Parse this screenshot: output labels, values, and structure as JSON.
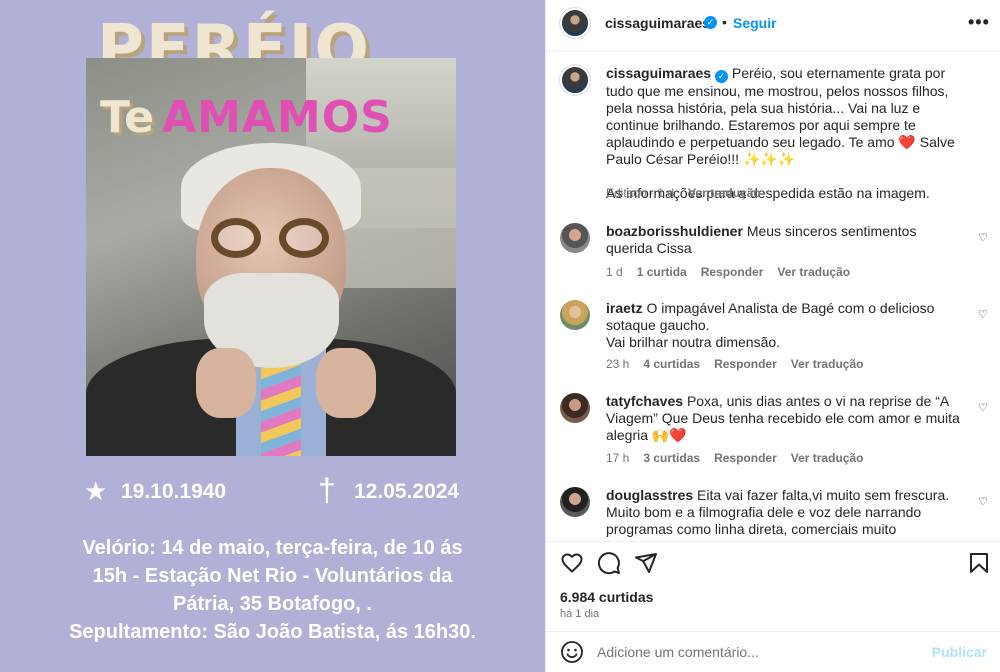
{
  "post_image": {
    "title_line1": "PERÉIO",
    "title_te": "Te",
    "title_amamos": "AMAMOS",
    "birth_date": "19.10.1940",
    "death_date": "12.05.2024",
    "info_lines": [
      "Velório: 14 de maio, terça-feira, de 10 ás",
      "15h - Estação Net Rio - Voluntários da",
      "Pátria, 35 Botafogo, .",
      "Sepultamento: São João Batista, ás 16h30."
    ]
  },
  "header": {
    "username": "cissaguimaraes",
    "separator": "•",
    "follow_label": "Seguir",
    "more": "•••"
  },
  "caption": {
    "username": "cissaguimaraes",
    "text": "Peréio, sou eternamente grata por tudo que me ensinou, me mostrou, pelos nossos filhos, pela nossa história, pela sua história... Vai na luz e continue brilhando. Estaremos por aqui sempre te aplaudindo e perpetuando seu legado. Te amo ❤️ Salve Paulo César Peréio!!! ✨✨✨",
    "text2": "As informações para a despedida estão na imagem.",
    "edited": "Editado · 1 d",
    "translate": "Ver tradução"
  },
  "comments": [
    {
      "user": "boazborisshuldiener",
      "text": "Meus sinceros sentimentos querida Cissa",
      "time": "1 d",
      "likes": "1 curtida",
      "reply": "Responder",
      "translate": "Ver tradução"
    },
    {
      "user": "iraetz",
      "text": "O impagável Analista de Bagé com o delicioso sotaque gaucho.",
      "text2": "Vai brilhar noutra dimensão.",
      "time": "23 h",
      "likes": "4 curtidas",
      "reply": "Responder",
      "translate": "Ver tradução"
    },
    {
      "user": "tatyfchaves",
      "text": "Poxa, unis dias antes o vi na reprise de “A Viagem” Que Deus tenha recebido ele com amor e muita alegria 🙌❤️",
      "time": "17 h",
      "likes": "3 curtidas",
      "reply": "Responder",
      "translate": "Ver tradução"
    },
    {
      "user": "douglasstres",
      "text": "Eita vai fazer falta,vi muito sem frescura. Muito bom e a filmografia dele e voz dele narrando programas como linha direta, comerciais muito marcante....",
      "time": "",
      "likes": "",
      "reply": "",
      "translate": ""
    }
  ],
  "actions": {
    "likes": "6.984 curtidas",
    "ago": "há 1 dia"
  },
  "composer": {
    "placeholder": "Adicione um comentário...",
    "publish": "Publicar"
  },
  "icons": {
    "heart": "heart-icon",
    "comment": "comment-icon",
    "share": "share-icon",
    "save": "bookmark-icon",
    "emoji": "emoji-icon",
    "verified": "verified-badge-icon"
  },
  "colors": {
    "accent": "#0095f6",
    "image_bg": "#b1b0d6",
    "title_pink": "#e04fb3"
  }
}
